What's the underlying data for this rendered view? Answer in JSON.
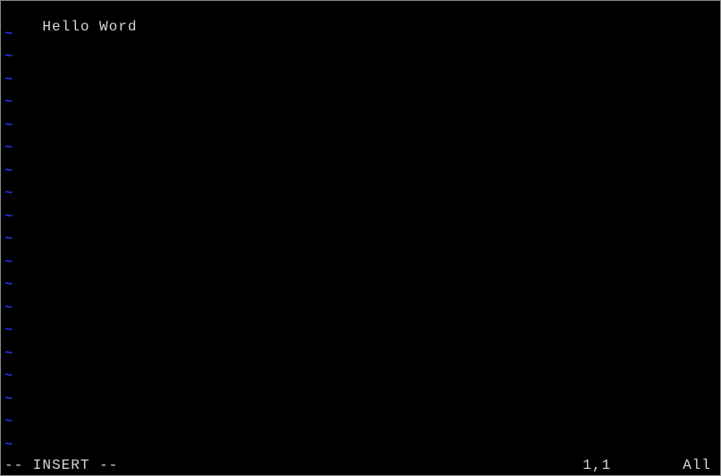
{
  "editor": {
    "content_line": "Hello Word",
    "tilde": "~",
    "empty_line_count": 19
  },
  "status": {
    "mode": "-- INSERT --",
    "position": "1,1",
    "percent": "All"
  }
}
